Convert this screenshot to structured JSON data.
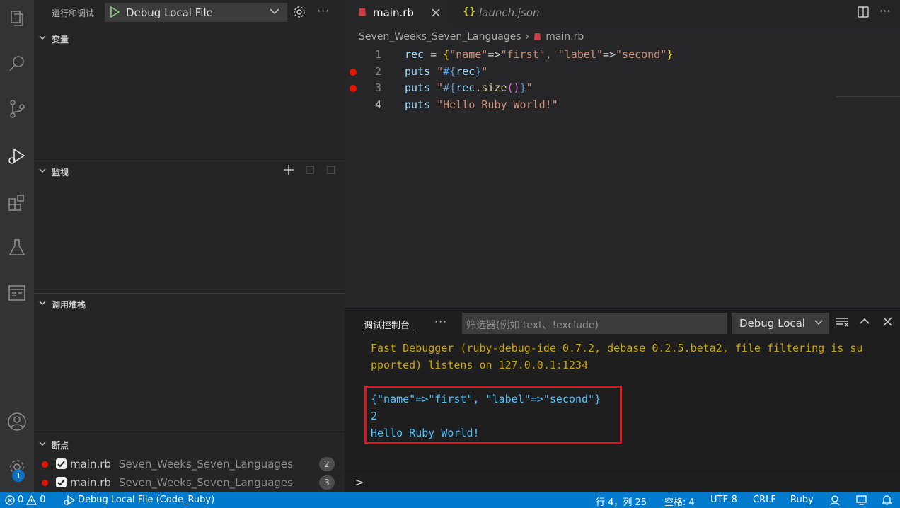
{
  "activity": {
    "items": [
      "explorer-icon",
      "search-icon",
      "source-control-icon",
      "run-debug-icon",
      "extensions-icon",
      "testing-icon",
      "remote-explorer-icon"
    ],
    "bottom": [
      "account-icon",
      "manage-gear-icon"
    ],
    "badge": "1"
  },
  "sidebar": {
    "title": "运行和调试",
    "config": "Debug Local File",
    "sections": {
      "variables": "变量",
      "watch": "监视",
      "callstack": "调用堆栈",
      "breakpoints": "断点"
    },
    "breakpoints": [
      {
        "file": "main.rb",
        "path": "Seven_Weeks_Seven_Languages",
        "line": "2",
        "checked": true
      },
      {
        "file": "main.rb",
        "path": "Seven_Weeks_Seven_Languages",
        "line": "3",
        "checked": true
      }
    ]
  },
  "editor": {
    "tabs": [
      {
        "label": "main.rb",
        "active": true
      },
      {
        "label": "launch.json",
        "active": false
      }
    ],
    "breadcrumb": [
      "Seven_Weeks_Seven_Languages",
      "main.rb"
    ],
    "lines": [
      {
        "n": "1",
        "breakpoint": false
      },
      {
        "n": "2",
        "breakpoint": true
      },
      {
        "n": "3",
        "breakpoint": true
      },
      {
        "n": "4",
        "breakpoint": false
      }
    ],
    "code": {
      "l1": {
        "a": "rec",
        "b": " = ",
        "c": "{",
        "d": "\"name\"",
        "e": "=>",
        "f": "\"first\"",
        "g": ", ",
        "h": "\"label\"",
        "i": "=>",
        "j": "\"second\"",
        "k": "}"
      },
      "l2": {
        "a": "puts",
        "b": " ",
        "c": "\"",
        "d": "#{",
        "e": "rec",
        "f": "}",
        "g": "\""
      },
      "l3": {
        "a": "puts",
        "b": " ",
        "c": "\"",
        "d": "#{",
        "e": "rec",
        "f": ".size",
        "g": "()",
        "h": "}",
        "i": "\""
      },
      "l4": {
        "a": "puts",
        "b": " ",
        "c": "\"Hello Ruby World!\""
      }
    }
  },
  "panel": {
    "tab": "调试控制台",
    "filter_placeholder": "筛选器(例如 text、!exclude)",
    "session": "Debug Local",
    "output": {
      "line1": "Fast Debugger (ruby-debug-ide 0.7.2, debase 0.2.5.beta2, file filtering is su",
      "line2": "pported) listens on 127.0.0.1:1234",
      "line3": "{\"name\"=>\"first\", \"label\"=>\"second\"}",
      "line4": "2",
      "line5": "Hello Ruby World!"
    },
    "prompt": ">"
  },
  "status": {
    "errors": "0",
    "warnings": "0",
    "debug": "Debug Local File (Code_Ruby)",
    "position": "行 4，列 25",
    "spaces": "空格: 4",
    "encoding": "UTF-8",
    "eol": "CRLF",
    "language": "Ruby"
  },
  "colors": {
    "accent": "#007acc",
    "breakpoint": "#e51400",
    "highlight": "#e0161e"
  }
}
